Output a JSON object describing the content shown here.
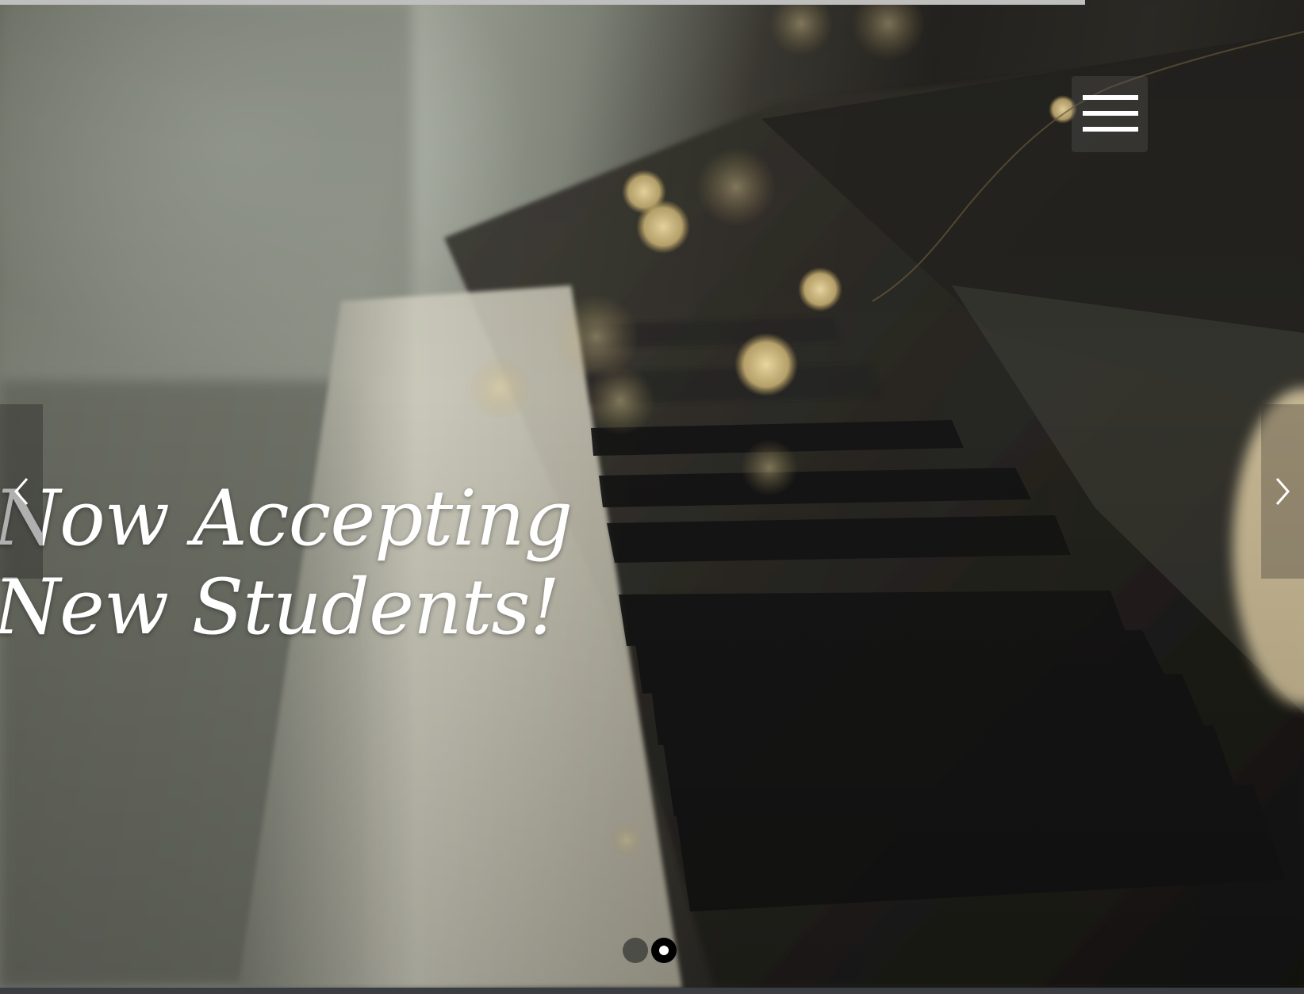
{
  "hero": {
    "headline_line1": "Now Accepting",
    "headline_line2": "New Students!",
    "background": "piano-keys-bokeh-photo"
  },
  "menu": {
    "icon": "hamburger-menu-icon"
  },
  "slider": {
    "prev_icon": "chevron-left-icon",
    "next_icon": "chevron-right-icon",
    "slides_total": 2,
    "active_slide": 2
  },
  "colors": {
    "text": "#ffffff",
    "bottom_strip": "#3a3d41",
    "top_bar": "#bfc0bd"
  }
}
